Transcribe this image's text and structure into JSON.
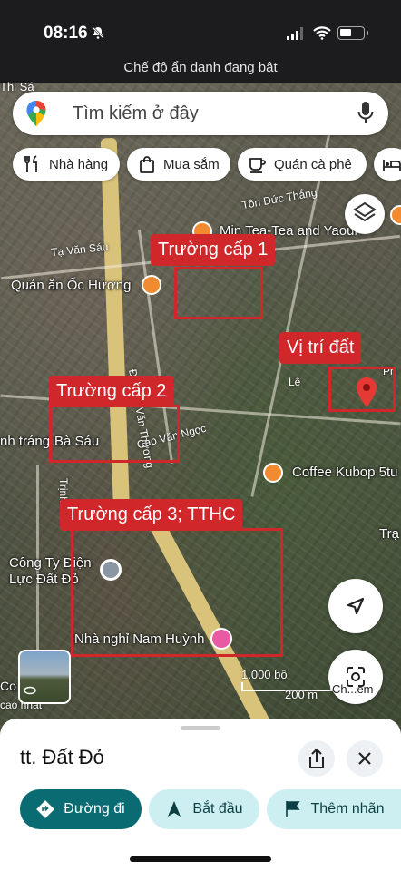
{
  "status_bar": {
    "time": "08:16",
    "incognito_notice": "Chế độ ẩn danh đang bật"
  },
  "search": {
    "placeholder": "Tìm kiếm ở đây"
  },
  "chips": [
    {
      "label": "Nhà hàng",
      "icon": "fork-knife-icon"
    },
    {
      "label": "Mua sắm",
      "icon": "shopping-bag-icon"
    },
    {
      "label": "Quán cà phê",
      "icon": "coffee-cup-icon"
    }
  ],
  "map": {
    "places": {
      "thi_sach": "Thi Sá",
      "ton_duc_thang": "Tôn Đức Thắng",
      "min_tea": "Min Tea-Tea and Yaour",
      "ta_van_sau": "Tạ Văn Sáu",
      "oc_huong": "Quán ăn Ốc Hương",
      "tran_van_thuong": "Đ. Trần Văn Thương",
      "le": "Lê",
      "ph": "Ph",
      "nh_trang": "nh tráng",
      "ba_sau": "Bà Sáu",
      "cao_van_ngoc": "Cao Văn Ngọc",
      "coffee_kubop": "Coffee Kubop 5tu",
      "trinh": "Trịnh",
      "trang": "Trạ",
      "dien_luc": "Công Ty Điện\nLực Đất Đỏ",
      "nha_nghi": "Nhà nghỉ Nam Huỳnh",
      "co": "Co",
      "cao_nhat": "cao nhất"
    },
    "annotations": {
      "truong_cap_1": "Trường cấp 1",
      "vi_tri_dat": "Vị trí đất",
      "truong_cap_2": "Trường cấp 2",
      "truong_cap_3": "Trường cấp 3; TTHC"
    },
    "scale": {
      "top": "1.000 bộ",
      "bottom": "200 m"
    },
    "lens_label": "Ch...em"
  },
  "sheet": {
    "title": "tt. Đất Đỏ",
    "actions": {
      "directions": "Đường đi",
      "start": "Bắt đầu",
      "label": "Thêm nhãn"
    }
  },
  "colors": {
    "annotation": "#d0272b",
    "primary": "#0b6b72",
    "secondary": "#cdeff1"
  }
}
